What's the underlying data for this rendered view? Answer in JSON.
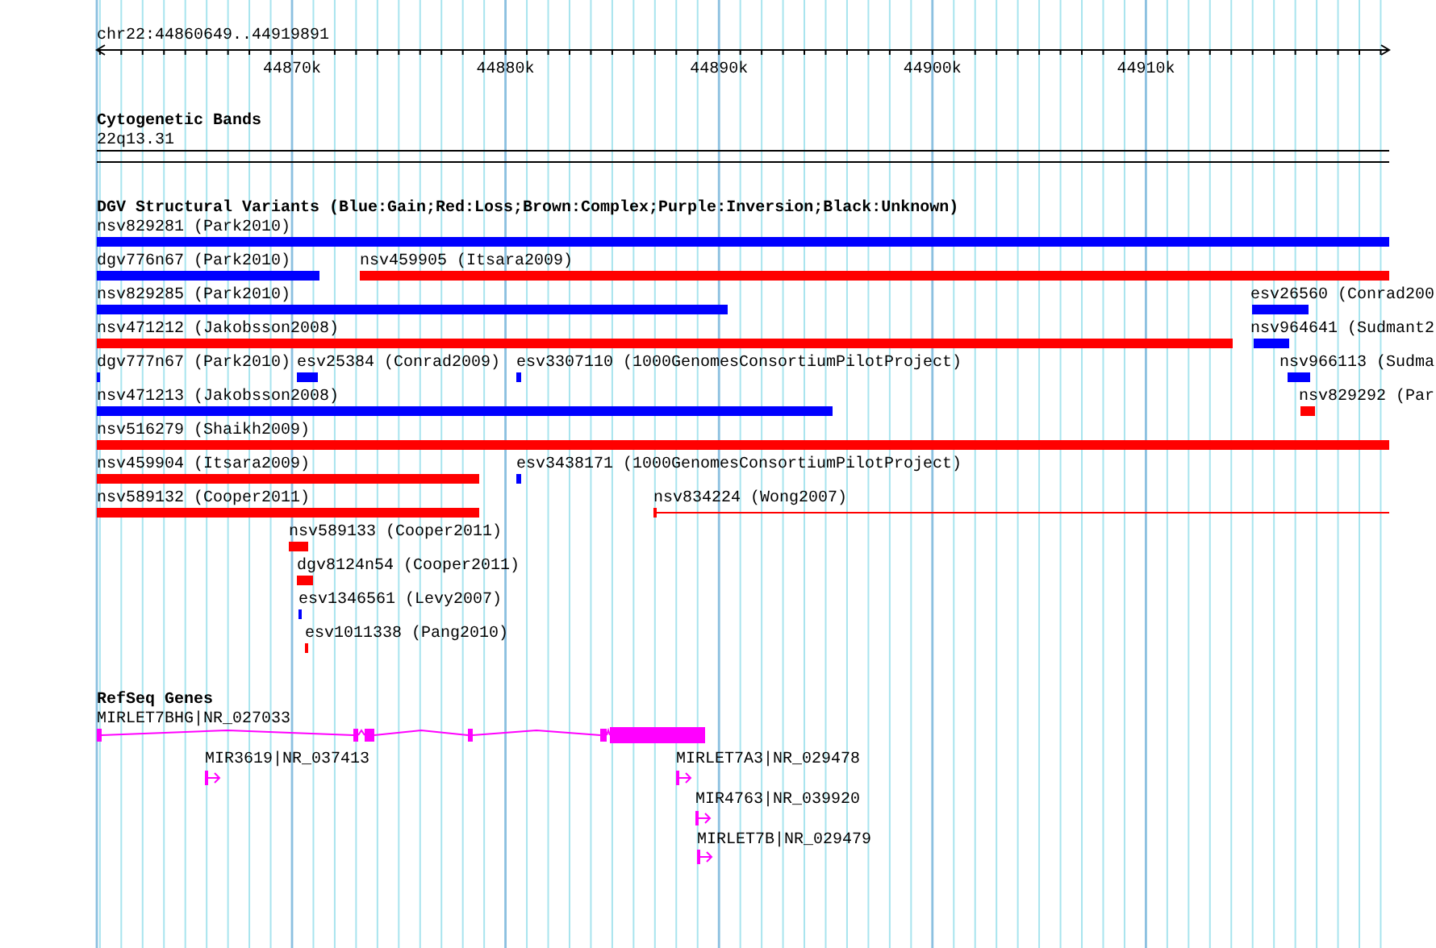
{
  "ruler": {
    "position": "chr22:44860649..44919891",
    "ticks": [
      "44870k",
      "44880k",
      "44890k",
      "44900k",
      "44910k"
    ]
  },
  "cytogenetic_bands": {
    "title": "Cytogenetic Bands",
    "band": "22q13.31"
  },
  "structural_variants": {
    "title": "DGV Structural Variants (Blue:Gain;Red:Loss;Brown:Complex;Purple:Inversion;Black:Unknown)",
    "features": [
      {
        "label": "nsv829281 (Park2010)",
        "color": "#0000ff",
        "kind": "bar"
      },
      {
        "label": "dgv776n67 (Park2010)",
        "color": "#0000ff",
        "kind": "bar"
      },
      {
        "label": "nsv459905 (Itsara2009)",
        "color": "#ff0000",
        "kind": "bar"
      },
      {
        "label": "nsv829285 (Park2010)",
        "color": "#0000ff",
        "kind": "bar"
      },
      {
        "label": "esv26560 (Conrad200",
        "color": "#0000ff",
        "kind": "bar"
      },
      {
        "label": "nsv471212 (Jakobsson2008)",
        "color": "#ff0000",
        "kind": "bar"
      },
      {
        "label": "nsv964641 (Sudmant2",
        "color": "#0000ff",
        "kind": "bar"
      },
      {
        "label": "dgv777n67 (Park2010)",
        "color": "#0000ff",
        "kind": "bar"
      },
      {
        "label": "esv25384 (Conrad2009)",
        "color": "#0000ff",
        "kind": "bar"
      },
      {
        "label": "esv3307110 (1000GenomesConsortiumPilotProject)",
        "color": "#0000ff",
        "kind": "bar"
      },
      {
        "label": "nsv966113 (Sudma",
        "color": "#0000ff",
        "kind": "bar"
      },
      {
        "label": "nsv471213 (Jakobsson2008)",
        "color": "#0000ff",
        "kind": "bar"
      },
      {
        "label": "nsv829292 (Par",
        "color": "#ff0000",
        "kind": "bar"
      },
      {
        "label": "nsv516279 (Shaikh2009)",
        "color": "#ff0000",
        "kind": "bar"
      },
      {
        "label": "nsv459904 (Itsara2009)",
        "color": "#ff0000",
        "kind": "bar"
      },
      {
        "label": "esv3438171 (1000GenomesConsortiumPilotProject)",
        "color": "#0000ff",
        "kind": "bar"
      },
      {
        "label": "nsv589132 (Cooper2011)",
        "color": "#ff0000",
        "kind": "bar"
      },
      {
        "label": "nsv834224 (Wong2007)",
        "color": "#ff0000",
        "kind": "line"
      },
      {
        "label": "nsv589133 (Cooper2011)",
        "color": "#ff0000",
        "kind": "bar"
      },
      {
        "label": "dgv8124n54 (Cooper2011)",
        "color": "#ff0000",
        "kind": "bar"
      },
      {
        "label": "esv1346561 (Levy2007)",
        "color": "#0000ff",
        "kind": "bar"
      },
      {
        "label": "esv1011338 (Pang2010)",
        "color": "#ff0000",
        "kind": "bar"
      }
    ]
  },
  "refseq_genes": {
    "title": "RefSeq Genes",
    "genes": [
      {
        "label": "MIRLET7BHG|NR_027033",
        "kind": "gene_model"
      },
      {
        "label": "MIR3619|NR_037413",
        "kind": "transcript_start"
      },
      {
        "label": "MIRLET7A3|NR_029478",
        "kind": "transcript_start"
      },
      {
        "label": "MIR4763|NR_039920",
        "kind": "transcript_start"
      },
      {
        "label": "MIRLET7B|NR_029479",
        "kind": "transcript_start"
      }
    ]
  }
}
